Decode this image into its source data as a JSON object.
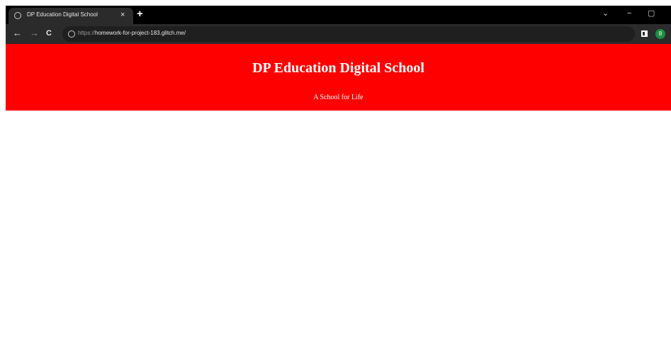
{
  "browser": {
    "tab": {
      "title": "DP Education Digital School",
      "close_label": "×",
      "favicon": "globe-icon"
    },
    "new_tab_label": "+",
    "window_controls": {
      "dropdown": "⌄",
      "minimize": "−",
      "restore": "▢"
    },
    "nav": {
      "back": "←",
      "forward": "→",
      "reload": "C"
    },
    "address_bar": {
      "scheme": "https://",
      "host_path": "homework-for-project-183.glitch.me/",
      "site_icon": "site-info-icon"
    },
    "profile_initial": "8"
  },
  "page": {
    "header": {
      "title": "DP Education Digital School",
      "subtitle": "A School for Life",
      "background_color": "#ff0000",
      "text_color": "#ffffff"
    }
  },
  "colors": {
    "tabbar": "#000000",
    "toolbar": "#2b2b2b",
    "omnibox": "#1f1f1f",
    "profile": "#1e8e3e"
  }
}
